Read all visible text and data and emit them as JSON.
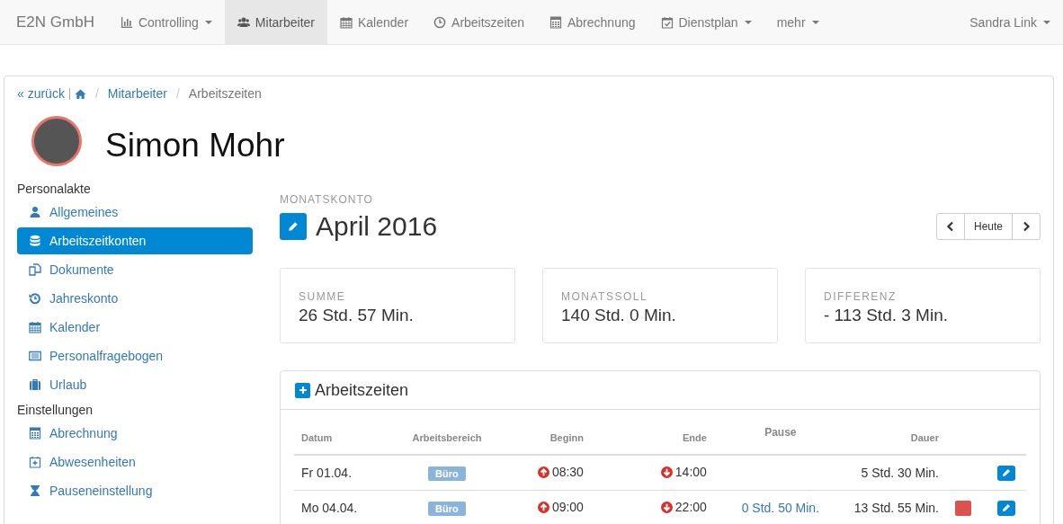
{
  "navbar": {
    "brand": "E2N GmbH",
    "items": [
      {
        "label": "Controlling",
        "selected": false,
        "dropdown": true
      },
      {
        "label": "Mitarbeiter",
        "selected": true,
        "dropdown": false
      },
      {
        "label": "Kalender",
        "selected": false,
        "dropdown": false
      },
      {
        "label": "Arbeitszeiten",
        "selected": false,
        "dropdown": false
      },
      {
        "label": "Abrechnung",
        "selected": false,
        "dropdown": false
      },
      {
        "label": "Dienstplan",
        "selected": false,
        "dropdown": true
      },
      {
        "label": "mehr",
        "selected": false,
        "dropdown": true
      }
    ],
    "user": {
      "label": "Sandra Link",
      "dropdown": true
    }
  },
  "breadcrumb": {
    "back": "« zurück",
    "separator": "/",
    "items": [
      "Mitarbeiter"
    ],
    "current": "Arbeitszeiten"
  },
  "employee": {
    "name": "Simon Mohr"
  },
  "sidebar": {
    "sections": [
      {
        "title": "Personalakte",
        "items": [
          {
            "label": "Allgemeines",
            "selected": false
          },
          {
            "label": "Arbeitszeitkonten",
            "selected": true
          },
          {
            "label": "Dokumente",
            "selected": false
          },
          {
            "label": "Jahreskonto",
            "selected": false
          },
          {
            "label": "Kalender",
            "selected": false
          },
          {
            "label": "Personalfragebogen",
            "selected": false
          },
          {
            "label": "Urlaub",
            "selected": false
          }
        ]
      },
      {
        "title": "Einstellungen",
        "items": [
          {
            "label": "Abrechnung",
            "selected": false
          },
          {
            "label": "Abwesenheiten",
            "selected": false
          },
          {
            "label": "Pauseneinstellung",
            "selected": false
          }
        ]
      }
    ]
  },
  "month": {
    "caption": "MONATSKONTO",
    "title": "April 2016",
    "nav": {
      "today": "Heute"
    }
  },
  "stats": [
    {
      "label": "SUMME",
      "value": "26 Std. 57 Min."
    },
    {
      "label": "MONATSSOLL",
      "value": "140 Std. 0 Min."
    },
    {
      "label": "DIFFERENZ",
      "value": "- 113 Std. 3 Min."
    }
  ],
  "worktimes": {
    "title": "Arbeitszeiten",
    "columns": [
      "Datum",
      "Arbeitsbereich",
      "Beginn",
      "Ende",
      "Pause",
      "Dauer"
    ],
    "rows": [
      {
        "date": "Fr 01.04.",
        "area": "Büro",
        "start": "08:30",
        "end": "14:00",
        "duration": "5 Std. 30 Min.",
        "flag": false
      },
      {
        "date": "Mo 04.04.",
        "area": "Büro",
        "start": "09:00",
        "end": "22:00",
        "pause": "0 Std. 50 Min.",
        "duration": "13 Std. 55 Min.",
        "flag": true
      }
    ]
  }
}
